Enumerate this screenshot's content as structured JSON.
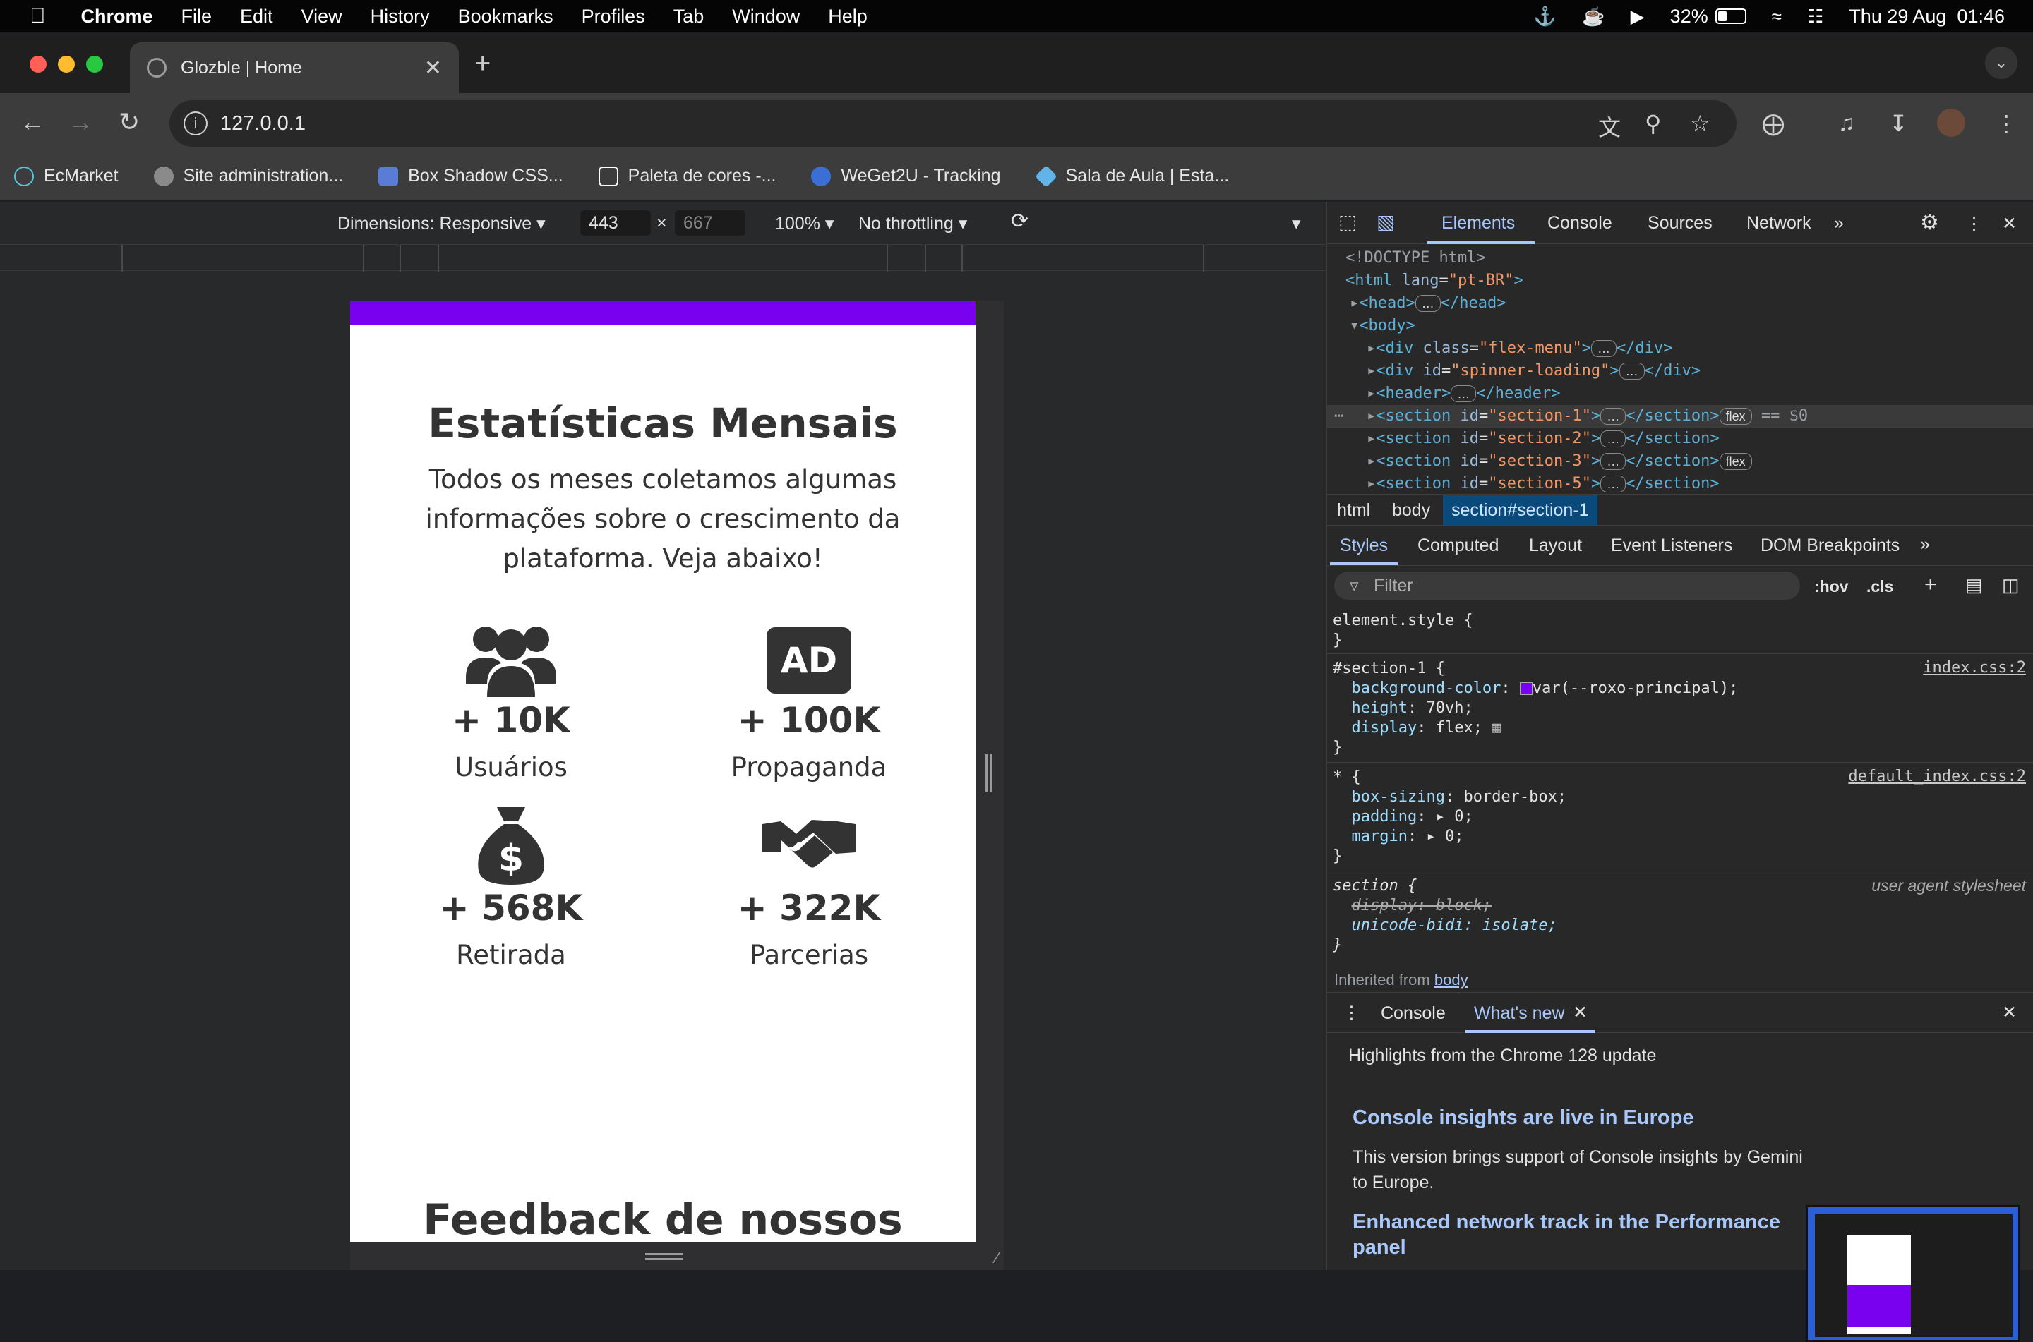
{
  "menubar": {
    "app": "Chrome",
    "items": [
      "File",
      "Edit",
      "View",
      "History",
      "Bookmarks",
      "Profiles",
      "Tab",
      "Window",
      "Help"
    ],
    "battery": "32%",
    "datetime": "Thu 29 Aug  01:46"
  },
  "tab": {
    "title": "Glozble | Home"
  },
  "address": {
    "url": "127.0.0.1"
  },
  "bookmarks": [
    {
      "label": "EcMarket",
      "color": "#58c4dc"
    },
    {
      "label": "Site administration...",
      "color": "#8a8a8a"
    },
    {
      "label": "Box Shadow CSS...",
      "color": "#5a7bd6"
    },
    {
      "label": "Paleta de cores -...",
      "color": "#ffffff"
    },
    {
      "label": "WeGet2U - Tracking",
      "color": "#3b6fd6"
    },
    {
      "label": "Sala de Aula | Esta...",
      "color": "#62b4e8"
    }
  ],
  "device_toolbar": {
    "dimensions": "Dimensions: Responsive",
    "width": "443",
    "height": "667",
    "zoom": "100%",
    "throttling": "No throttling"
  },
  "page": {
    "title": "Estatísticas Mensais",
    "subtitle": "Todos os meses coletamos algumas informações sobre o crescimento da plataforma. Veja abaixo!",
    "ad_badge": "AD",
    "stats": [
      {
        "value": "+ 10K",
        "label": "Usuários",
        "icon": "users-icon"
      },
      {
        "value": "+ 100K",
        "label": "Propaganda",
        "icon": "ad-icon"
      },
      {
        "value": "+ 568K",
        "label": "Retirada",
        "icon": "money-bag-icon"
      },
      {
        "value": "+ 322K",
        "label": "Parcerias",
        "icon": "handshake-icon"
      }
    ],
    "next_section_title": "Feedback de nossos"
  },
  "devtools": {
    "tabs": [
      "Elements",
      "Console",
      "Sources",
      "Network"
    ],
    "active_tab": "Elements",
    "dom": {
      "doctype": "<!DOCTYPE html>",
      "html_lang": "pt-BR",
      "lines": {
        "head": "head",
        "body": "body",
        "div1_class": "flex-menu",
        "div2_id": "spinner-loading",
        "header": "header",
        "s1": "section-1",
        "s2": "section-2",
        "s3": "section-3",
        "s5": "section-5"
      },
      "selected_marker": "== $0",
      "flex_badge": "flex"
    },
    "breadcrumbs": [
      "html",
      "body",
      "section#section-1"
    ],
    "style_tabs": [
      "Styles",
      "Computed",
      "Layout",
      "Event Listeners",
      "DOM Breakpoints"
    ],
    "filter_placeholder": "Filter",
    "hov": ":hov",
    "cls": ".cls",
    "rules": {
      "element_style": "element.style {",
      "section1_selector": "#section-1 {",
      "section1_src": "index.css:2",
      "bg_prop": "background-color",
      "bg_val": "var(--roxo-principal);",
      "height_prop": "height",
      "height_val": "70vh;",
      "display_prop": "display",
      "display_val": "flex;",
      "star_selector": "* {",
      "star_src": "default_index.css:2",
      "boxsizing_prop": "box-sizing",
      "boxsizing_val": "border-box;",
      "padding_prop": "padding",
      "padding_val": "0;",
      "margin_prop": "margin",
      "margin_val": "0;",
      "section_selector": "section {",
      "section_src": "user agent stylesheet",
      "ua_display": "display: block;",
      "ua_unicode": "unicode-bidi: isolate;",
      "inherited": "Inherited from",
      "inherited_from": "body",
      "purple": "#7a00f0"
    },
    "drawer": {
      "tabs": [
        "Console",
        "What's new"
      ],
      "heading": "Highlights from the Chrome 128 update",
      "item1_title": "Console insights are live in Europe",
      "item1_body": "This version brings support of Console insights by Gemini to Europe.",
      "item2_title": "Enhanced network track in the Performance panel"
    }
  }
}
